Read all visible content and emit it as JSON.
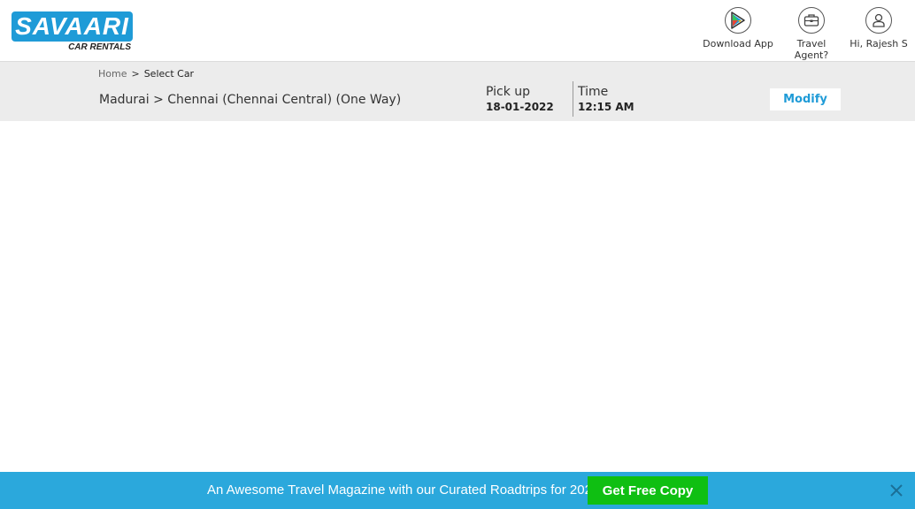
{
  "header": {
    "logo": {
      "text": "SAVAARI",
      "subtext": "CAR RENTALS"
    },
    "nav": [
      {
        "label": "Download App",
        "icon": "play-store-icon"
      },
      {
        "label": "Travel Agent?",
        "icon": "briefcase-icon"
      },
      {
        "label": "Hi, Rajesh S",
        "icon": "user-icon"
      }
    ]
  },
  "breadcrumb": {
    "home": "Home",
    "separator": ">",
    "current": "Select Car"
  },
  "trip": {
    "route": "Madurai > Chennai (Chennai Central) (One Way)",
    "pickup_label": "Pick up",
    "pickup_date": "18-01-2022",
    "time_label": "Time",
    "time_value": "12:15 AM",
    "modify_label": "Modify"
  },
  "banner": {
    "text": "An Awesome Travel Magazine with our Curated Roadtrips for 2022",
    "button_label": "Get Free Copy",
    "close_icon": "close-icon"
  },
  "colors": {
    "brand": "#1f9bd7",
    "banner_bg": "#2ba8dc",
    "cta_green": "#0fbf12",
    "bar_bg": "#ececec"
  }
}
